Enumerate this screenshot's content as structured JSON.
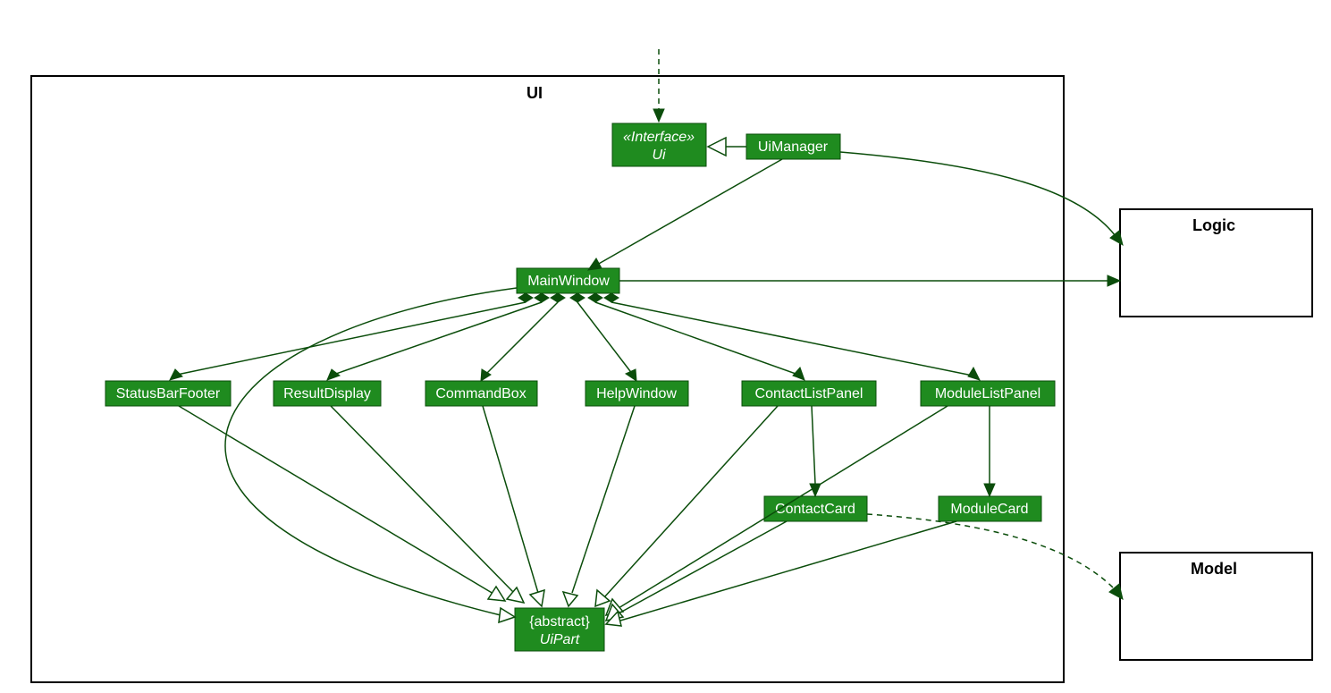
{
  "packages": {
    "ui": {
      "label": "UI"
    },
    "logic": {
      "label": "Logic"
    },
    "model": {
      "label": "Model"
    }
  },
  "classes": {
    "ui_iface": {
      "stereo": "«Interface»",
      "name": "Ui"
    },
    "ui_manager": {
      "name": "UiManager"
    },
    "main_window": {
      "name": "MainWindow"
    },
    "status_bar_footer": {
      "name": "StatusBarFooter"
    },
    "result_display": {
      "name": "ResultDisplay"
    },
    "command_box": {
      "name": "CommandBox"
    },
    "help_window": {
      "name": "HelpWindow"
    },
    "contact_list_panel": {
      "name": "ContactListPanel"
    },
    "module_list_panel": {
      "name": "ModuleListPanel"
    },
    "contact_card": {
      "name": "ContactCard"
    },
    "module_card": {
      "name": "ModuleCard"
    },
    "ui_part": {
      "stereo": "{abstract}",
      "name": "UiPart"
    }
  },
  "relations": [
    {
      "from": "external",
      "to": "ui_iface",
      "type": "dependency"
    },
    {
      "from": "ui_manager",
      "to": "ui_iface",
      "type": "realization"
    },
    {
      "from": "ui_manager",
      "to": "main_window",
      "type": "association-nav"
    },
    {
      "from": "ui_manager",
      "to": "logic",
      "type": "association-nav"
    },
    {
      "from": "main_window",
      "to": "logic",
      "type": "association-nav"
    },
    {
      "from": "main_window",
      "to": "status_bar_footer",
      "type": "composition"
    },
    {
      "from": "main_window",
      "to": "result_display",
      "type": "composition"
    },
    {
      "from": "main_window",
      "to": "command_box",
      "type": "composition"
    },
    {
      "from": "main_window",
      "to": "help_window",
      "type": "composition"
    },
    {
      "from": "main_window",
      "to": "contact_list_panel",
      "type": "composition"
    },
    {
      "from": "main_window",
      "to": "module_list_panel",
      "type": "composition"
    },
    {
      "from": "contact_list_panel",
      "to": "contact_card",
      "type": "association-nav"
    },
    {
      "from": "module_list_panel",
      "to": "module_card",
      "type": "association-nav"
    },
    {
      "from": "main_window",
      "to": "ui_part",
      "type": "generalization"
    },
    {
      "from": "status_bar_footer",
      "to": "ui_part",
      "type": "generalization"
    },
    {
      "from": "result_display",
      "to": "ui_part",
      "type": "generalization"
    },
    {
      "from": "command_box",
      "to": "ui_part",
      "type": "generalization"
    },
    {
      "from": "help_window",
      "to": "ui_part",
      "type": "generalization"
    },
    {
      "from": "contact_list_panel",
      "to": "ui_part",
      "type": "generalization"
    },
    {
      "from": "module_list_panel",
      "to": "ui_part",
      "type": "generalization"
    },
    {
      "from": "contact_card",
      "to": "ui_part",
      "type": "generalization"
    },
    {
      "from": "module_card",
      "to": "ui_part",
      "type": "generalization"
    },
    {
      "from": "contact_card",
      "to": "model",
      "type": "dependency"
    },
    {
      "from": "module_card",
      "to": "model",
      "type": "dependency"
    }
  ]
}
